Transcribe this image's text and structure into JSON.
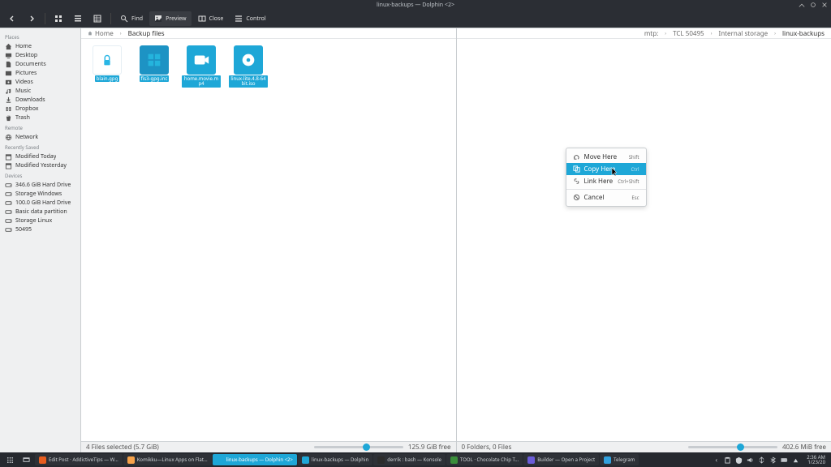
{
  "window": {
    "title": "linux-backups — Dolphin <2>"
  },
  "toolbar": {
    "find": "Find",
    "preview": "Preview",
    "close": "Close",
    "control": "Control"
  },
  "sidebar": {
    "sections": [
      {
        "head": "Places",
        "items": [
          {
            "icon": "home",
            "label": "Home"
          },
          {
            "icon": "monitor",
            "label": "Desktop"
          },
          {
            "icon": "doc",
            "label": "Documents"
          },
          {
            "icon": "pic",
            "label": "Pictures"
          },
          {
            "icon": "vid",
            "label": "Videos"
          },
          {
            "icon": "music",
            "label": "Music"
          },
          {
            "icon": "dl",
            "label": "Downloads"
          },
          {
            "icon": "dropbox",
            "label": "Dropbox"
          },
          {
            "icon": "trash",
            "label": "Trash"
          }
        ]
      },
      {
        "head": "Remote",
        "items": [
          {
            "icon": "net",
            "label": "Network"
          }
        ]
      },
      {
        "head": "Recently Saved",
        "items": [
          {
            "icon": "cal",
            "label": "Modified Today"
          },
          {
            "icon": "cal",
            "label": "Modified Yesterday"
          }
        ]
      },
      {
        "head": "Devices",
        "items": [
          {
            "icon": "disk",
            "label": "346.6 GiB Hard Drive"
          },
          {
            "icon": "disk",
            "label": "Storage Windows"
          },
          {
            "icon": "disk",
            "label": "100.0 GiB Hard Drive"
          },
          {
            "icon": "disk",
            "label": "Basic data partition"
          },
          {
            "icon": "disk",
            "label": "Storage Linux"
          },
          {
            "icon": "disk",
            "label": "50495"
          }
        ]
      }
    ]
  },
  "panes": {
    "left": {
      "crumbs": [
        {
          "label": "Home",
          "active": false
        },
        {
          "label": "Backup files",
          "active": true
        }
      ],
      "files": [
        {
          "name": "blain.gpg",
          "type": "gpg",
          "sel": true
        },
        {
          "name": "fis3-gpg.inc",
          "type": "app",
          "sel": true
        },
        {
          "name": "home.movie.mp4",
          "type": "vid",
          "sel": true
        },
        {
          "name": "linux-lite.4.8-64bit.iso",
          "type": "iso",
          "sel": true
        }
      ],
      "status": "4 Files selected (5.7 GiB)",
      "free": "125.9 GiB free",
      "zoom_pct": 55
    },
    "right": {
      "prefix": "mtp:",
      "crumbs": [
        {
          "label": "TCL 50495",
          "active": false
        },
        {
          "label": "Internal storage",
          "active": false
        },
        {
          "label": "linux-backups",
          "active": true
        }
      ],
      "status": "0 Folders, 0 Files",
      "free": "402.6 MiB free",
      "zoom_pct": 55
    }
  },
  "ctx": {
    "items": [
      {
        "icon": "undo",
        "label": "Move Here",
        "shortcut": "Shift",
        "hl": false
      },
      {
        "icon": "copy",
        "label": "Copy Here",
        "shortcut": "Ctrl",
        "hl": true
      },
      {
        "icon": "link",
        "label": "Link Here",
        "shortcut": "Ctrl+Shift",
        "hl": false
      }
    ],
    "cancel": {
      "icon": "cancel",
      "label": "Cancel",
      "shortcut": "Esc"
    }
  },
  "taskbar": {
    "tasks": [
      {
        "color": "#e85d1f",
        "label": "Edit Post · AddictiveTips — W…"
      },
      {
        "color": "#f7a24a",
        "label": "Komikku—Linux Apps on Flat…"
      },
      {
        "color": "#1ea7d7",
        "label": "linux-backups — Dolphin <2>",
        "active": true
      },
      {
        "color": "#1ea7d7",
        "label": "linux-backups — Dolphin"
      },
      {
        "color": "#2c2c2c",
        "label": "derrik : bash — Konsole"
      },
      {
        "color": "#3b8e3b",
        "label": "TOOL · Chocolate Chip T…"
      },
      {
        "color": "#6b5cd8",
        "label": "Builder — Open a Project"
      },
      {
        "color": "#32a1de",
        "label": "Telegram"
      }
    ],
    "clock": {
      "time": "2:36 AM",
      "date": "1/23/20"
    }
  }
}
